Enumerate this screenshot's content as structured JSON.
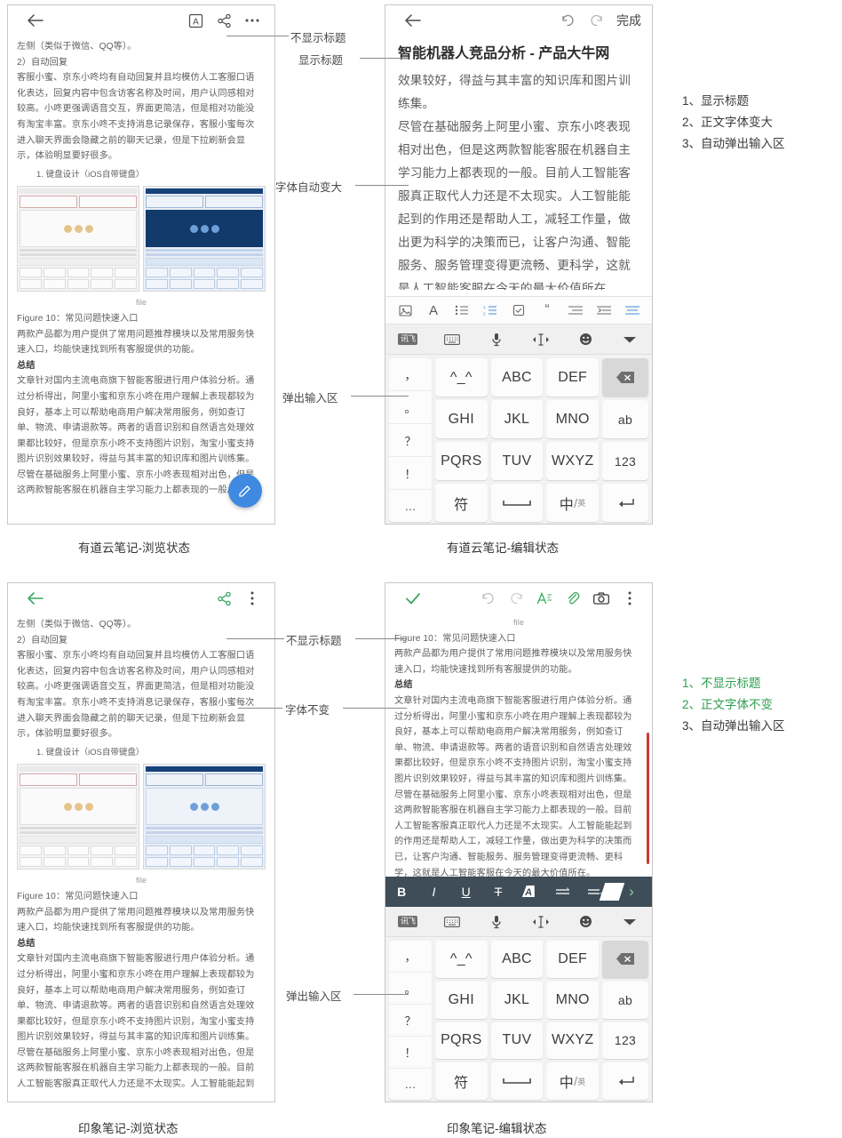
{
  "panels": {
    "youdao_view": {
      "caption": "有道云笔记-浏览状态",
      "topbar": {
        "back_icon": "back-arrow-icon",
        "font_icon": "font-size-icon",
        "share_icon": "share-icon",
        "more_icon": "more-icon"
      },
      "body_lines": [
        "左侧（类似于微信、QQ等）。",
        "2）自动回复",
        "客服小蜜、京东小咚均有自动回复并且均模仿人工客服口语",
        "化表达，回复内容中包含访客名称及时间，用户认同感相对",
        "较高。小咚更强调语音交互，界面更简洁，但是相对功能没",
        "有淘宝丰富。京东小咚不支持消息记录保存，客服小蜜每次",
        "进入聊天界面会隐藏之前的聊天记录，但是下拉刷新会显",
        "示，体验明显要好很多。"
      ],
      "sub_item": "1. 键盘设计（iOS自带键盘）",
      "image_caption_small": "file",
      "figure_caption": "Figure 10：常见问题快速入口",
      "after_figure": [
        "两款产品都为用户提供了常用问题推荐模块以及常用服务快",
        "速入口，均能快速找到所有客服提供的功能。"
      ],
      "section_heading": "总结",
      "summary_lines": [
        "文章针对国内主流电商旗下智能客服进行用户体验分析。通",
        "过分析得出，阿里小蜜和京东小咚在用户理解上表现都较为",
        "良好，基本上可以帮助电商用户解决常用服务，例如查订",
        "单、物流、申请退款等。两者的语音识别和自然语言处理效",
        "果都比较好，但是京东小咚不支持图片识别，淘宝小蜜支持",
        "图片识别效果较好，得益与其丰富的知识库和图片训练集。",
        "尽管在基础服务上阿里小蜜、京东小咚表现相对出色，但是",
        "这两款智能客服在机器自主学习能力上都表现的一般。目前"
      ],
      "fab_icon": "edit-pencil-icon"
    },
    "youdao_edit": {
      "caption": "有道云笔记-编辑状态",
      "topbar": {
        "back_icon": "back-arrow-icon",
        "undo_icon": "undo-icon",
        "redo_icon": "redo-icon",
        "done_label": "完成"
      },
      "title": "智能机器人竞品分析 - 产品大牛网",
      "body_lines": [
        "效果较好，得益与其丰富的知识库和图片训",
        "练集。",
        "尽管在基础服务上阿里小蜜、京东小咚表现",
        "相对出色，但是这两款智能客服在机器自主",
        "学习能力上都表现的一般。目前人工智能客",
        "服真正取代人力还是不太现实。人工智能能",
        "起到的作用还是帮助人工，减轻工作量，做",
        "出更为科学的决策而已，让客户沟通、智能",
        "服务、服务管理变得更流畅、更科学，这就",
        "是人工智能客服在今天的最大价值所在"
      ],
      "format_toolbar": [
        "image-icon",
        "font-icon",
        "bullet-list-icon",
        "numbered-list-icon",
        "checkbox-list-icon",
        "quote-icon",
        "indent-decrease-icon",
        "indent-increase-icon",
        "align-icon"
      ]
    },
    "yinxiang_view": {
      "caption": "印象笔记-浏览状态",
      "topbar": {
        "back_icon": "back-arrow-icon",
        "share_icon": "share-icon",
        "more_icon": "more-vertical-icon"
      },
      "body_lines": [
        "左侧（类似于微信、QQ等）。",
        "2）自动回复",
        "客服小蜜、京东小咚均有自动回复并且均模仿人工客服口语",
        "化表达，回复内容中包含访客名称及时间，用户认同感相对",
        "较高。小咚更强调语音交互，界面更简洁，但是相对功能没",
        "有淘宝丰富。京东小咚不支持消息记录保存，客服小蜜每次",
        "进入聊天界面会隐藏之前的聊天记录，但是下拉刷新会显",
        "示，体验明显要好很多。"
      ],
      "sub_item": "1. 键盘设计（iOS自带键盘）",
      "image_caption_small": "file",
      "figure_caption": "Figure 10：常见问题快速入口",
      "after_figure": [
        "两款产品都为用户提供了常用问题推荐模块以及常用服务快",
        "速入口，均能快速找到所有客服提供的功能。"
      ],
      "section_heading": "总结",
      "summary_lines": [
        "文章针对国内主流电商旗下智能客服进行用户体验分析。通",
        "过分析得出，阿里小蜜和京东小咚在用户理解上表现都较为",
        "良好，基本上可以帮助电商用户解决常用服务，例如查订",
        "单、物流、申请退款等。两者的语音识别和自然语言处理效",
        "果都比较好，但是京东小咚不支持图片识别，淘宝小蜜支持",
        "图片识别效果较好，得益与其丰富的知识库和图片训练集。",
        "尽管在基础服务上阿里小蜜、京东小咚表现相对出色，但是",
        "这两款智能客服在机器自主学习能力上都表现的一般。目前",
        "人工智能客服真正取代人力还是不太现实。人工智能能起到"
      ]
    },
    "yinxiang_edit": {
      "caption": "印象笔记-编辑状态",
      "topbar": {
        "done_icon": "check-icon",
        "undo_icon": "undo-icon",
        "redo_icon": "redo-icon",
        "font_icon": "font-format-icon",
        "attach_icon": "paperclip-icon",
        "camera_icon": "camera-icon",
        "more_icon": "more-vertical-icon"
      },
      "image_caption_small": "file",
      "figure_caption": "Figure 10：常见问题快速入口",
      "after_figure": [
        "两款产品都为用户提供了常用问题推荐模块以及常用服务快",
        "速入口，均能快速找到所有客服提供的功能。"
      ],
      "section_heading": "总结",
      "summary_lines": [
        "文章针对国内主流电商旗下智能客服进行用户体验分析。通",
        "过分析得出，阿里小蜜和京东小咚在用户理解上表现都较为",
        "良好，基本上可以帮助电商用户解决常用服务，例如查订",
        "单、物流、申请退款等。两者的语音识别和自然语言处理效",
        "果都比较好，但是京东小咚不支持图片识别，淘宝小蜜支持",
        "图片识别效果较好，得益与其丰富的知识库和图片训练集。",
        "尽管在基础服务上阿里小蜜、京东小咚表现相对出色，但是",
        "这两款智能客服在机器自主学习能力上都表现的一般。目前",
        "人工智能客服真正取代人力还是不太现实。人工智能能起到",
        "的作用还是帮助人工，减轻工作量，做出更为科学的决策而",
        "已，让客户沟通、智能服务、服务管理变得更流畅、更科",
        "学，这就是人工智能客服在今天的最大价值所在。"
      ],
      "format_toolbar": [
        "B",
        "I",
        "U",
        "T",
        "A",
        "list-icon",
        "indent-icon"
      ],
      "format_toolbar_names": [
        "bold-icon",
        "italic-icon",
        "underline-icon",
        "strikethrough-icon",
        "highlight-icon",
        "bullet-list-icon",
        "indent-icon"
      ],
      "expand_icon": "chevron-right-icon"
    }
  },
  "keyboard": {
    "function_row": [
      "xunfei-logo",
      "keyboard-icon",
      "microphone-icon",
      "cursor-move-icon",
      "emoji-icon",
      "collapse-icon"
    ],
    "punct_column": [
      "，",
      "。",
      "？",
      "！",
      "…"
    ],
    "rows": [
      [
        "^_^",
        "ABC",
        "DEF",
        "delete-icon"
      ],
      [
        "GHI",
        "JKL",
        "MNO",
        "ab"
      ],
      [
        "PQRS",
        "TUV",
        "WXYZ",
        "123"
      ],
      [
        "符",
        "space-icon",
        "中/英",
        "enter-icon"
      ]
    ],
    "zh_en_main": "中",
    "zh_en_sub": "英"
  },
  "annotations": {
    "top_left_label": "不显示标题",
    "top_right_label": "显示标题",
    "font_enlarge_label": "字体自动变大",
    "popup_input_label_top": "弹出输入区",
    "bottom_no_title_label": "不显示标题",
    "font_unchanged_label": "字体不变",
    "popup_input_label_bottom": "弹出输入区"
  },
  "notes": {
    "top": [
      {
        "num": "1、",
        "text": "显示标题",
        "color": "#3a3a3a"
      },
      {
        "num": "2、",
        "text": "正文字体变大",
        "color": "#3a3a3a"
      },
      {
        "num": "3、",
        "text": "自动弹出输入区",
        "color": "#3a3a3a"
      }
    ],
    "bottom": [
      {
        "num": "1、",
        "text": "不显示标题",
        "color": "#2e9e4e"
      },
      {
        "num": "2、",
        "text": "正文字体不变",
        "color": "#2e9e4e"
      },
      {
        "num": "3、",
        "text": "自动弹出输入区",
        "color": "#3a3a3a"
      }
    ]
  },
  "colors": {
    "accent_blue": "#3f8ae0",
    "accent_green": "#2e9e4e",
    "toolbar_dark": "#3e4d57",
    "scrollbar_red": "#cc3b33"
  }
}
